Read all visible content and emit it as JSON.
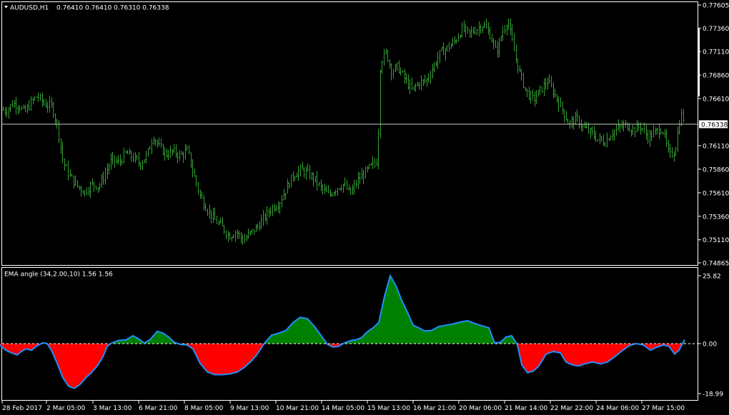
{
  "price_header": {
    "symbol_timeframe": "AUDUSD,H1",
    "ohlc": "0.76410 0.76410 0.76310 0.76338"
  },
  "indicator_header": "EMA angle (34,2.00,10) 1.56 1.56",
  "colors": {
    "background": "#000000",
    "bars": "#33a033",
    "frame": "#ffffff",
    "hline": "#c8c8c8",
    "positive_fill": "#008000",
    "negative_fill": "#ff0000",
    "angle_line": "#1e90ff",
    "zero_line": "#ffffff"
  },
  "chart_data": [
    {
      "type": "bar",
      "title": "AUDUSD,H1 0.76410 0.76410 0.76310 0.76338",
      "y_ticks": [
        "0.77605",
        "0.77360",
        "0.77110",
        "0.76860",
        "0.76610",
        "0.76338",
        "0.76110",
        "0.75860",
        "0.75610",
        "0.75360",
        "0.75110",
        "0.74865"
      ],
      "ylim": [
        0.74865,
        0.77605
      ],
      "current_price": 0.76338,
      "x_tick_labels": [
        "28 Feb 2017",
        "2 Mar 05:00",
        "3 Mar 13:00",
        "6 Mar 21:00",
        "8 Mar 05:00",
        "9 Mar 13:00",
        "10 Mar 21:00",
        "14 Mar 05:00",
        "15 Mar 13:00",
        "16 Mar 21:00",
        "20 Mar 06:00",
        "21 Mar 14:00",
        "22 Mar 22:00",
        "24 Mar 06:00",
        "27 Mar 15:00"
      ],
      "close_path": [
        [
          0,
          0.765
        ],
        [
          8,
          0.7648
        ],
        [
          18,
          0.7656
        ],
        [
          26,
          0.7654
        ],
        [
          34,
          0.7646
        ],
        [
          44,
          0.7658
        ],
        [
          52,
          0.7664
        ],
        [
          62,
          0.7655
        ],
        [
          72,
          0.7653
        ],
        [
          80,
          0.7632
        ],
        [
          88,
          0.7593
        ],
        [
          98,
          0.7578
        ],
        [
          108,
          0.7568
        ],
        [
          118,
          0.7562
        ],
        [
          128,
          0.757
        ],
        [
          138,
          0.7568
        ],
        [
          146,
          0.758
        ],
        [
          156,
          0.7596
        ],
        [
          166,
          0.7593
        ],
        [
          176,
          0.7603
        ],
        [
          186,
          0.7598
        ],
        [
          196,
          0.7592
        ],
        [
          206,
          0.7602
        ],
        [
          214,
          0.7622
        ],
        [
          222,
          0.761
        ],
        [
          232,
          0.7602
        ],
        [
          242,
          0.7605
        ],
        [
          252,
          0.76
        ],
        [
          262,
          0.7606
        ],
        [
          270,
          0.7582
        ],
        [
          280,
          0.7557
        ],
        [
          290,
          0.7543
        ],
        [
          300,
          0.7532
        ],
        [
          310,
          0.7525
        ],
        [
          320,
          0.7515
        ],
        [
          330,
          0.752
        ],
        [
          340,
          0.751
        ],
        [
          350,
          0.7518
        ],
        [
          360,
          0.7525
        ],
        [
          370,
          0.7535
        ],
        [
          380,
          0.7545
        ],
        [
          390,
          0.755
        ],
        [
          400,
          0.7565
        ],
        [
          410,
          0.758
        ],
        [
          420,
          0.7585
        ],
        [
          430,
          0.7582
        ],
        [
          440,
          0.7575
        ],
        [
          450,
          0.7565
        ],
        [
          460,
          0.7558
        ],
        [
          470,
          0.7566
        ],
        [
          480,
          0.757
        ],
        [
          490,
          0.756
        ],
        [
          500,
          0.7574
        ],
        [
          510,
          0.7582
        ],
        [
          520,
          0.759
        ],
        [
          528,
          0.7595
        ],
        [
          532,
          0.77
        ],
        [
          540,
          0.771
        ],
        [
          548,
          0.769
        ],
        [
          556,
          0.7695
        ],
        [
          566,
          0.7682
        ],
        [
          576,
          0.767
        ],
        [
          586,
          0.7678
        ],
        [
          596,
          0.768
        ],
        [
          606,
          0.7695
        ],
        [
          616,
          0.771
        ],
        [
          626,
          0.7715
        ],
        [
          636,
          0.7722
        ],
        [
          646,
          0.7735
        ],
        [
          656,
          0.773
        ],
        [
          666,
          0.7735
        ],
        [
          676,
          0.774
        ],
        [
          686,
          0.7728
        ],
        [
          694,
          0.771
        ],
        [
          702,
          0.773
        ],
        [
          710,
          0.7745
        ],
        [
          718,
          0.7715
        ],
        [
          726,
          0.769
        ],
        [
          736,
          0.7668
        ],
        [
          746,
          0.766
        ],
        [
          756,
          0.767
        ],
        [
          766,
          0.768
        ],
        [
          776,
          0.7665
        ],
        [
          786,
          0.765
        ],
        [
          796,
          0.7634
        ],
        [
          806,
          0.764
        ],
        [
          816,
          0.763
        ],
        [
          826,
          0.7625
        ],
        [
          836,
          0.7618
        ],
        [
          846,
          0.7615
        ],
        [
          856,
          0.7625
        ],
        [
          866,
          0.763
        ],
        [
          876,
          0.7633
        ],
        [
          886,
          0.7628
        ],
        [
          896,
          0.7632
        ],
        [
          906,
          0.762
        ],
        [
          916,
          0.7625
        ],
        [
          926,
          0.763
        ],
        [
          936,
          0.76
        ],
        [
          944,
          0.7605
        ],
        [
          952,
          0.7645
        ],
        [
          960,
          0.7634
        ]
      ]
    },
    {
      "type": "area",
      "title": "EMA angle (34,2.00,10) 1.56 1.56",
      "y_ticks": [
        "25.82",
        "0.00",
        "-18.99"
      ],
      "ylim": [
        -18.99,
        25.82
      ],
      "series": [
        {
          "values": [
            [
              0,
              -0.5
            ],
            [
              8,
              -2.5
            ],
            [
              16,
              -3.5
            ],
            [
              24,
              -4.3
            ],
            [
              30,
              -3.0
            ],
            [
              36,
              -2.0
            ],
            [
              44,
              -2.5
            ],
            [
              52,
              -0.8
            ],
            [
              60,
              0.3
            ],
            [
              66,
              0
            ],
            [
              72,
              -2.5
            ],
            [
              80,
              -7.5
            ],
            [
              88,
              -13.0
            ],
            [
              96,
              -16.2
            ],
            [
              104,
              -17.0
            ],
            [
              112,
              -15.5
            ],
            [
              120,
              -13.0
            ],
            [
              128,
              -11.0
            ],
            [
              136,
              -8.5
            ],
            [
              144,
              -5.0
            ],
            [
              150,
              -1.0
            ],
            [
              156,
              0.2
            ],
            [
              166,
              1.2
            ],
            [
              176,
              1.4
            ],
            [
              186,
              3.0
            ],
            [
              194,
              1.8
            ],
            [
              202,
              0.2
            ],
            [
              210,
              1.5
            ],
            [
              220,
              4.7
            ],
            [
              228,
              4.0
            ],
            [
              236,
              2.5
            ],
            [
              244,
              0.5
            ],
            [
              252,
              -0.3
            ],
            [
              262,
              -0.5
            ],
            [
              270,
              -2.0
            ],
            [
              280,
              -7.5
            ],
            [
              290,
              -10.7
            ],
            [
              300,
              -11.8
            ],
            [
              312,
              -11.8
            ],
            [
              322,
              -11.5
            ],
            [
              332,
              -10.8
            ],
            [
              342,
              -9.0
            ],
            [
              352,
              -6.5
            ],
            [
              360,
              -4.0
            ],
            [
              370,
              0.2
            ],
            [
              380,
              3.2
            ],
            [
              390,
              4.0
            ],
            [
              400,
              5.0
            ],
            [
              410,
              8.0
            ],
            [
              420,
              10.0
            ],
            [
              430,
              9.5
            ],
            [
              440,
              6.5
            ],
            [
              450,
              2.8
            ],
            [
              458,
              -0.2
            ],
            [
              466,
              -1.3
            ],
            [
              474,
              -1.0
            ],
            [
              482,
              0.3
            ],
            [
              492,
              1.2
            ],
            [
              500,
              1.6
            ],
            [
              506,
              2.3
            ],
            [
              514,
              4.5
            ],
            [
              522,
              6.0
            ],
            [
              530,
              8.0
            ],
            [
              538,
              18.0
            ],
            [
              546,
              25.8
            ],
            [
              554,
              22.0
            ],
            [
              562,
              16.5
            ],
            [
              570,
              12.0
            ],
            [
              578,
              7.0
            ],
            [
              586,
              6.0
            ],
            [
              594,
              4.8
            ],
            [
              604,
              5.0
            ],
            [
              614,
              6.5
            ],
            [
              624,
              7.0
            ],
            [
              634,
              7.5
            ],
            [
              644,
              8.2
            ],
            [
              654,
              8.7
            ],
            [
              664,
              7.7
            ],
            [
              674,
              6.8
            ],
            [
              684,
              6.0
            ],
            [
              692,
              0.3
            ],
            [
              700,
              0.5
            ],
            [
              708,
              2.5
            ],
            [
              716,
              3.0
            ],
            [
              724,
              -0.5
            ],
            [
              730,
              -8.0
            ],
            [
              738,
              -11.0
            ],
            [
              746,
              -10.5
            ],
            [
              754,
              -8.5
            ],
            [
              764,
              -4.0
            ],
            [
              774,
              -3.0
            ],
            [
              784,
              -3.5
            ],
            [
              792,
              -7.0
            ],
            [
              800,
              -8.0
            ],
            [
              810,
              -8.5
            ],
            [
              820,
              -7.5
            ],
            [
              830,
              -7.0
            ],
            [
              840,
              -7.7
            ],
            [
              850,
              -7.0
            ],
            [
              860,
              -5.0
            ],
            [
              870,
              -2.8
            ],
            [
              880,
              -0.8
            ],
            [
              890,
              0.0
            ],
            [
              900,
              -0.5
            ],
            [
              910,
              -2.5
            ],
            [
              918,
              -1.5
            ],
            [
              928,
              -0.5
            ],
            [
              936,
              -1.0
            ],
            [
              944,
              -4.0
            ],
            [
              950,
              -2.5
            ],
            [
              958,
              1.5
            ]
          ]
        }
      ]
    }
  ]
}
